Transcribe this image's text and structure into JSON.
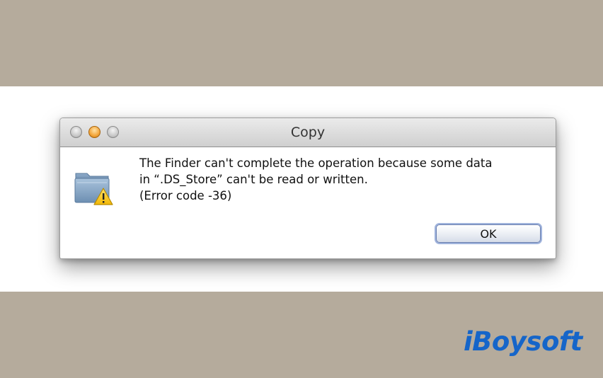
{
  "dialog": {
    "title": "Copy",
    "message_lines": [
      "The Finder can't complete the operation because some data",
      "in “.DS_Store” can't be read or written.",
      "(Error code -36)"
    ],
    "ok_label": "OK",
    "icon": "folder-warning-icon",
    "traffic_lights": [
      "close-icon",
      "minimize-icon",
      "maximize-icon"
    ]
  },
  "watermark": {
    "text": "iBoysoft",
    "color": "#1565c9"
  },
  "colors": {
    "background": "#b5ab9c",
    "band": "#ffffff",
    "minimize_orange": "#f3a53a"
  }
}
